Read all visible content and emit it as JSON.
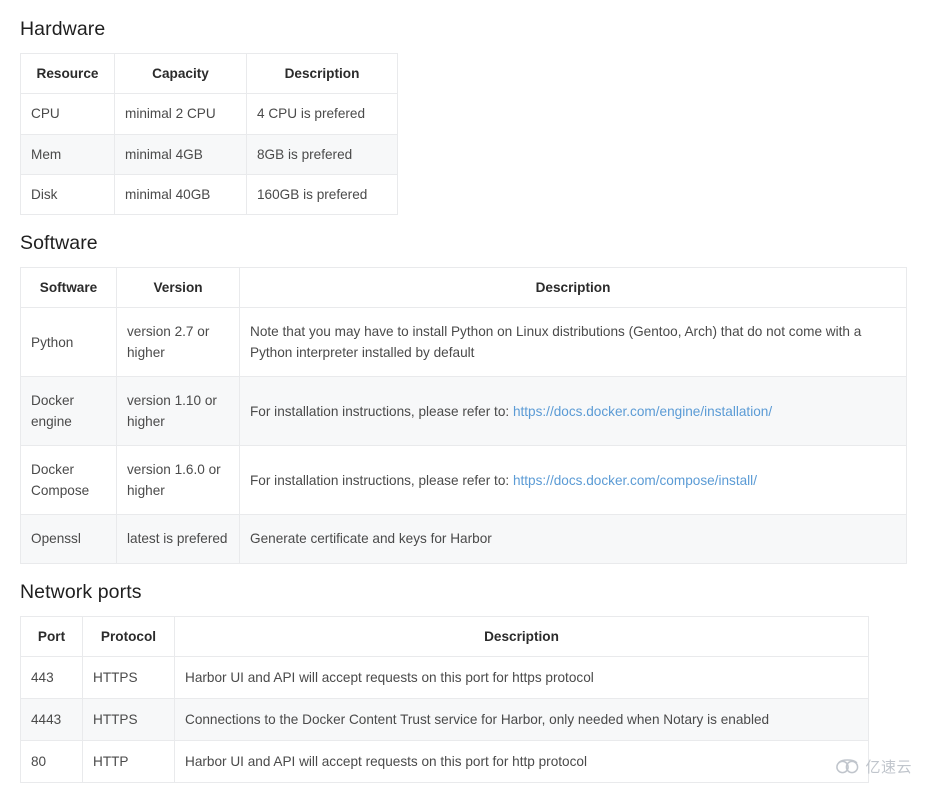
{
  "sections": [
    {
      "id": "hardware",
      "title": "Hardware",
      "columns": [
        "Resource",
        "Capacity",
        "Description"
      ],
      "rows": [
        [
          "CPU",
          "minimal 2 CPU",
          "4 CPU is prefered"
        ],
        [
          "Mem",
          "minimal 4GB",
          "8GB is prefered"
        ],
        [
          "Disk",
          "minimal 40GB",
          "160GB is prefered"
        ]
      ]
    },
    {
      "id": "software",
      "title": "Software",
      "columns": [
        "Software",
        "Version",
        "Description"
      ],
      "rows": [
        {
          "name": "Python",
          "version": "version 2.7 or higher",
          "desc_prefix": "Note that you may have to install Python on Linux distributions (Gentoo, Arch) that do not come with a Python interpreter installed by default",
          "link": ""
        },
        {
          "name": "Docker engine",
          "version": "version 1.10 or higher",
          "desc_prefix": "For installation instructions, please refer to: ",
          "link": "https://docs.docker.com/engine/installation/"
        },
        {
          "name": "Docker Compose",
          "version": "version 1.6.0 or higher",
          "desc_prefix": "For installation instructions, please refer to: ",
          "link": "https://docs.docker.com/compose/install/"
        },
        {
          "name": "Openssl",
          "version": "latest is prefered",
          "desc_prefix": "Generate certificate and keys for Harbor",
          "link": ""
        }
      ]
    },
    {
      "id": "network",
      "title": "Network ports",
      "columns": [
        "Port",
        "Protocol",
        "Description"
      ],
      "rows": [
        [
          "443",
          "HTTPS",
          "Harbor UI and API will accept requests on this port for https protocol"
        ],
        [
          "4443",
          "HTTPS",
          "Connections to the Docker Content Trust service for Harbor, only needed when Notary is enabled"
        ],
        [
          "80",
          "HTTP",
          "Harbor UI and API will accept requests on this port for http protocol"
        ]
      ]
    }
  ],
  "watermark": {
    "text": "亿速云",
    "icon": "cloud-icon"
  },
  "colors": {
    "link": "#5b9bd5",
    "border": "#e9eaec",
    "stripe": "#f7f8f9",
    "heading": "#1f1f1f",
    "body_text": "#4a4a4a"
  }
}
